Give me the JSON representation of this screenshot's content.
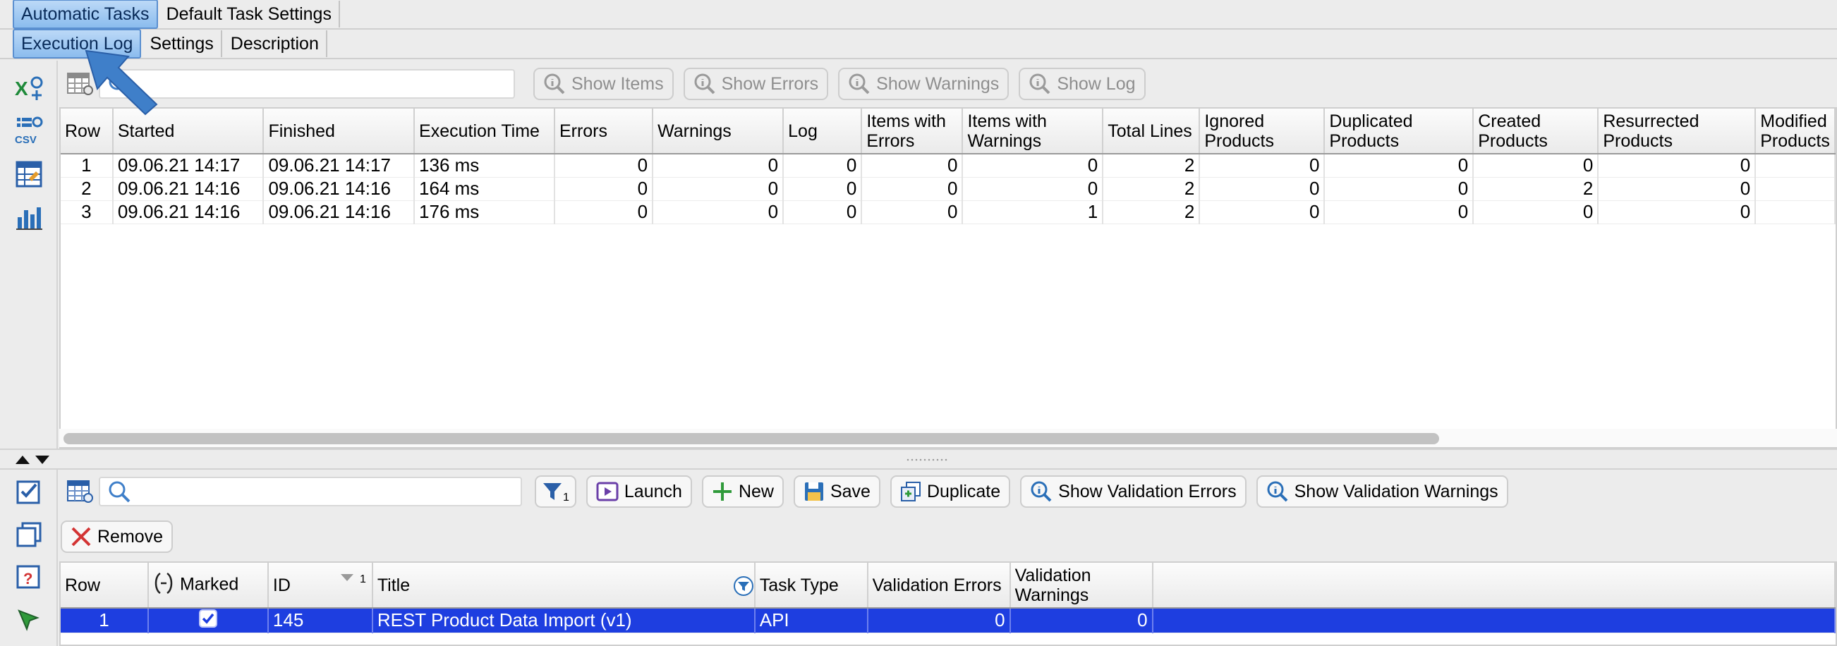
{
  "tabs_main": [
    {
      "label": "Automatic Tasks",
      "active": true
    },
    {
      "label": "Default Task Settings",
      "active": false
    }
  ],
  "tabs_sub": [
    {
      "label": "Execution Log",
      "active": true
    },
    {
      "label": "Settings",
      "active": false
    },
    {
      "label": "Description",
      "active": false
    }
  ],
  "left_icons_top": [
    "excel-export-icon",
    "csv-export-icon",
    "table-edit-icon",
    "bar-chart-icon"
  ],
  "left_icons_bottom": [
    "check-list-icon",
    "copy-icon",
    "help-icon",
    "cursor-icon"
  ],
  "top_toolbar": {
    "search_value": "",
    "buttons": {
      "show_items": "Show Items",
      "show_errors": "Show Errors",
      "show_warnings": "Show Warnings",
      "show_log": "Show Log"
    }
  },
  "execution_log": {
    "columns": [
      "Row",
      "Started",
      "Finished",
      "Execution Time",
      "Errors",
      "Warnings",
      "Log",
      "Items with Errors",
      "Items with Warnings",
      "Total Lines",
      "Ignored Products",
      "Duplicated Products",
      "Created Products",
      "Resurrected Products",
      "Modified Products"
    ],
    "rows": [
      [
        "1",
        "09.06.21 14:17",
        "09.06.21 14:17",
        "136 ms",
        "0",
        "0",
        "0",
        "0",
        "0",
        "2",
        "0",
        "0",
        "0",
        "0",
        ""
      ],
      [
        "2",
        "09.06.21 14:16",
        "09.06.21 14:16",
        "164 ms",
        "0",
        "0",
        "0",
        "0",
        "0",
        "2",
        "0",
        "0",
        "2",
        "0",
        ""
      ],
      [
        "3",
        "09.06.21 14:16",
        "09.06.21 14:16",
        "176 ms",
        "0",
        "0",
        "0",
        "0",
        "1",
        "2",
        "0",
        "0",
        "0",
        "0",
        ""
      ]
    ]
  },
  "bottom_toolbar": {
    "search_value": "",
    "filter_count": "1",
    "buttons": {
      "launch": "Launch",
      "new": "New",
      "save": "Save",
      "duplicate": "Duplicate",
      "show_validation_errors": "Show Validation Errors",
      "show_validation_warnings": "Show Validation Warnings",
      "remove": "Remove"
    }
  },
  "tasks_table": {
    "columns": [
      "Row",
      "Marked",
      "ID",
      "Title",
      "Task Type",
      "Validation Errors",
      "Validation Warnings"
    ],
    "id_sort_index": "1",
    "rows": [
      {
        "row": "1",
        "marked": true,
        "id": "145",
        "title": "REST Product Data Import (v1)",
        "task_type": "API",
        "validation_errors": "0",
        "validation_warnings": "0",
        "selected": true
      }
    ]
  },
  "colors": {
    "accent": "#5a8fd0",
    "selection": "#1e3ee0",
    "callout_arrow": "#3f7fc9",
    "remove_red": "#d33434",
    "new_green": "#2f9a3a"
  }
}
